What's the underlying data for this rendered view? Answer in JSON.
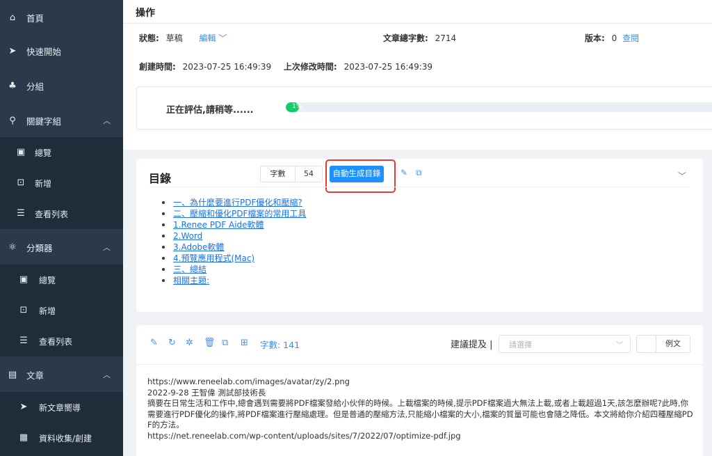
{
  "sidebar": {
    "items": [
      {
        "icon": "home-icon",
        "glyph": "⌂",
        "label": "首頁"
      },
      {
        "icon": "send-icon",
        "glyph": "➤",
        "label": "快速開始"
      },
      {
        "icon": "group-icon",
        "glyph": "♣",
        "label": "分組"
      },
      {
        "icon": "search-icon",
        "glyph": "⚲",
        "label": "關鍵字組"
      },
      {
        "icon": "category-icon",
        "glyph": "⚛",
        "label": "分類器"
      },
      {
        "icon": "document-icon",
        "glyph": "▤",
        "label": "文章"
      }
    ],
    "keyword_sub": [
      {
        "glyph": "▣",
        "label": "總覽"
      },
      {
        "glyph": "⊡",
        "label": "新增"
      },
      {
        "glyph": "☰",
        "label": "查看列表"
      }
    ],
    "classifier_sub": [
      {
        "glyph": "▣",
        "label": "總覽"
      },
      {
        "glyph": "⊡",
        "label": "新增"
      },
      {
        "glyph": "☰",
        "label": "查看列表"
      }
    ],
    "article_sub": [
      {
        "glyph": "➤",
        "label": "新文章嚮導"
      },
      {
        "glyph": "▦",
        "label": "資料收集/創建"
      }
    ]
  },
  "header": {
    "title": "操作",
    "status_label": "狀態:",
    "status_value": "草稿",
    "edit_label": "編輯",
    "wordcount_label": "文章總字數:",
    "wordcount_value": "2714",
    "version_label": "版本:",
    "version_value": "0",
    "view_link": "查閱",
    "created_label": "創建時間:",
    "created_value": "2023-07-25 16:49:39",
    "modified_label": "上次修改時間:",
    "modified_value": "2023-07-25 16:49:39"
  },
  "evaluation": {
    "text": "正在評估,請稍等......",
    "progress_text": "1%",
    "progress_fraction": 0.01
  },
  "toc": {
    "title": "目錄",
    "wordcount_key": "字數",
    "wordcount_value": "54",
    "auto_button": "自動生成目錄",
    "items": [
      "一、為什麼要進行PDF優化和壓縮?",
      "二、壓縮和優化PDF檔案的常用工具",
      "1.Renee PDF Aide軟體",
      "2.Word",
      "3.Adobe軟體",
      "4.預覽應用程式(Mac)",
      "三、總結",
      "相關主題:"
    ]
  },
  "editor": {
    "wordcount": "字數: 141",
    "suggest_label": "建議提及 |",
    "select_placeholder": "請選擇",
    "example_button": "例文",
    "lines": [
      "https://www.reneelab.com/images/avatar/zy/2.png",
      "2022-9-28 王智偉 測試部技術長",
      "摘要在日常生活和工作中,總會遇到需要將PDF檔案發給小伙伴的時候。上載檔案的時候,提示PDF檔案過大無法上載,或者上載超過1天,該怎麼辦呢?此時,你需要進行PDF優化的操作,將PDF檔案進行壓縮處理。但是普通的壓縮方法,只能縮小檔案的大小,檔案的質量可能也會隨之降低。本文將給你介紹四種壓縮PDF的方法。",
      "https://net.reneelab.com/wp-content/uploads/sites/7/2022/07/optimize-pdf.jpg"
    ]
  }
}
